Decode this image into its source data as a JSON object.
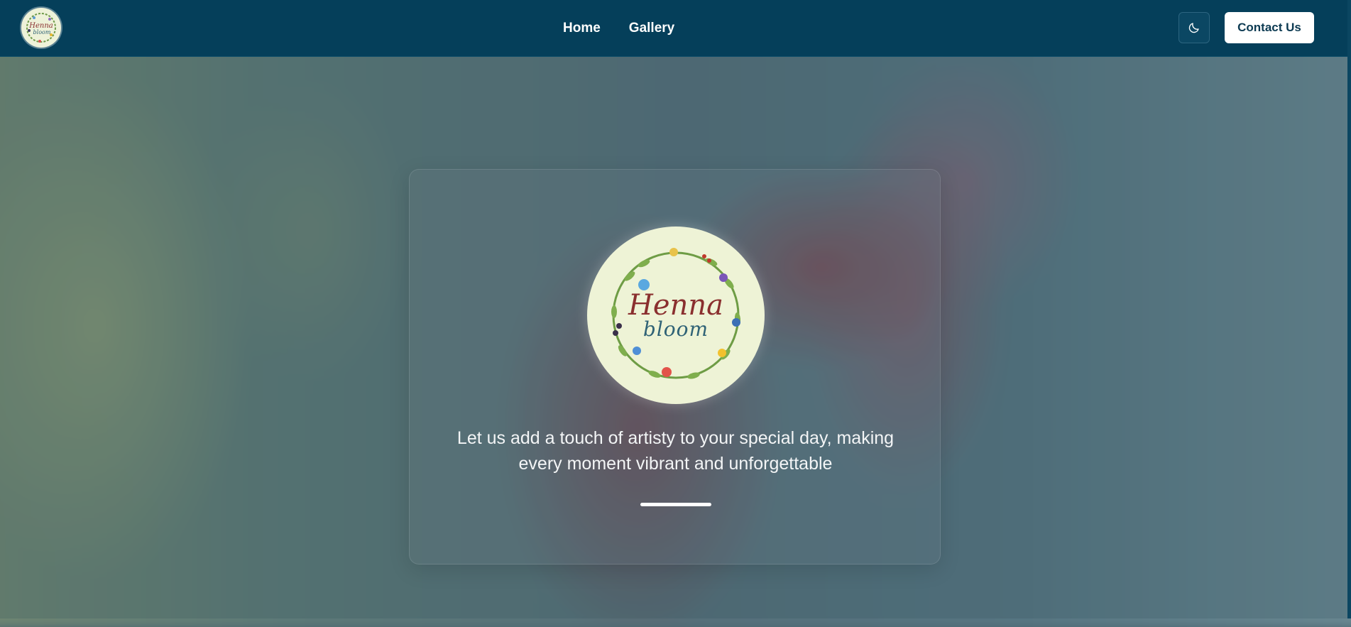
{
  "brand": {
    "logo_line1": "Henna",
    "logo_line2": "bloom"
  },
  "nav": {
    "links": [
      {
        "label": "Home"
      },
      {
        "label": "Gallery"
      }
    ],
    "theme_toggle_icon": "moon-icon",
    "contact_label": "Contact Us"
  },
  "hero": {
    "tagline_line1": "Let us add a touch of artisty to your special day, making",
    "tagline_line2": "every moment vibrant and unforgettable"
  },
  "colors": {
    "navbar": "#053f5a",
    "logo_background": "#eef3d6",
    "logo_henna": "#8a2f2f",
    "logo_bloom": "#2f6276",
    "contact_button": "#ffffff",
    "contact_text": "#0c3a52"
  }
}
